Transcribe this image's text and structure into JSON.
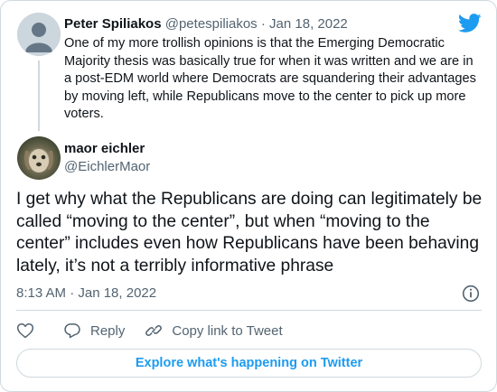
{
  "colors": {
    "brand": "#1d9bf0",
    "text": "#0f1419",
    "secondary": "#536471",
    "border": "#cfd9de"
  },
  "parent_tweet": {
    "name": "Peter Spiliakos",
    "handle": "@petespiliakos",
    "separator": "·",
    "date": "Jan 18, 2022",
    "text": "One of my more trollish opinions is that the Emerging Democratic Majority thesis was basically true for when it was written and we are in a post-EDM world where Democrats are squandering their advantages by moving left, while Republicans move to the center to pick up more voters."
  },
  "main_tweet": {
    "name": "maor eichler",
    "handle": "@EichlerMaor",
    "text": "I get why what the Republicans are doing can legitimately be called “moving to the center”, but when “moving to the center” includes even how Republicans have been behaving lately, it’s not a terribly informative phrase",
    "timestamp": "8:13 AM · Jan 18, 2022"
  },
  "actions": {
    "reply_label": "Reply",
    "copy_link_label": "Copy link to Tweet"
  },
  "explore_label": "Explore what's happening on Twitter",
  "icons": [
    "twitter-bird-icon",
    "heart-icon",
    "reply-icon",
    "link-icon",
    "info-icon",
    "default-avatar-icon"
  ]
}
